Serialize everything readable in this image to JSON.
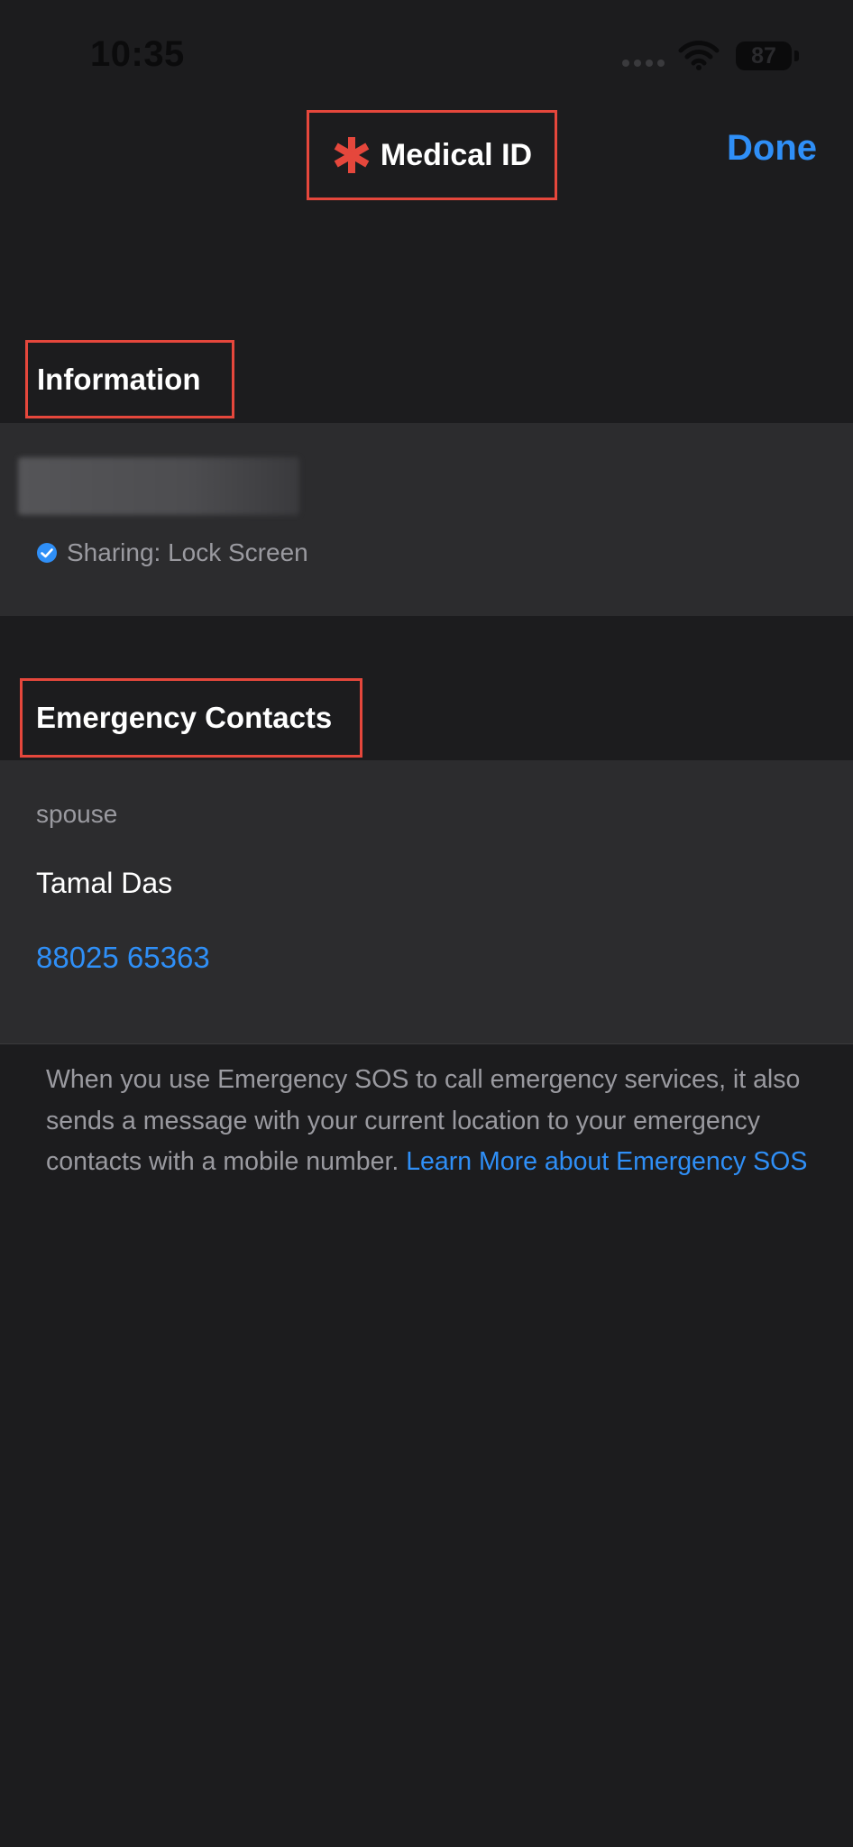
{
  "status_bar": {
    "time": "10:35",
    "battery": "87",
    "icons": [
      "cellular-icon",
      "wifi-icon",
      "battery-icon"
    ]
  },
  "nav": {
    "title": "Medical ID",
    "title_icon": "medical-asterisk-icon",
    "done_label": "Done"
  },
  "information": {
    "header": "Information",
    "sharing_text": "Sharing: Lock Screen",
    "sharing_icon": "checkmark-circle-icon"
  },
  "emergency_contacts": {
    "header": "Emergency Contacts",
    "contacts": [
      {
        "relation": "spouse",
        "name": "Tamal Das",
        "phone": "88025 65363"
      }
    ]
  },
  "footer": {
    "note": "When you use Emergency SOS to call emergency services, it also sends a message with your current location to your emergency contacts with a mobile number. ",
    "link_text": "Learn More about Emergency SOS"
  },
  "colors": {
    "background": "#1c1c1e",
    "card": "#2c2c2e",
    "accent_blue": "#2f8ff7",
    "highlight_red": "#e5473c",
    "secondary_text": "#9a9aa0"
  }
}
